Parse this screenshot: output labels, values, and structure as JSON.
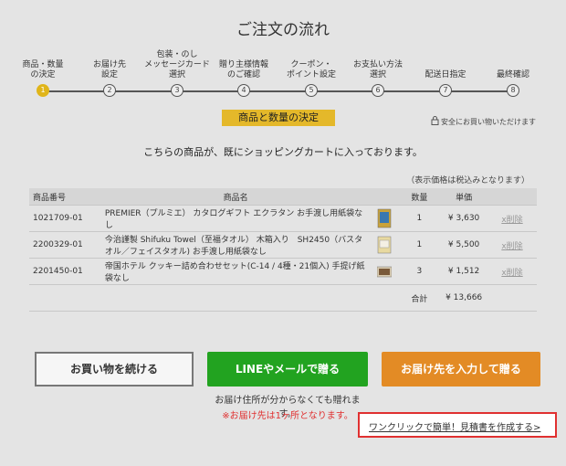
{
  "page_title": "ご注文の流れ",
  "steps": [
    {
      "label": "商品・数量\nの決定",
      "num": "1"
    },
    {
      "label": "お届け先\n設定",
      "num": "2"
    },
    {
      "label": "包装・のし\nメッセージカード\n選択",
      "num": "3"
    },
    {
      "label": "贈り主様情報\nのご確認",
      "num": "4"
    },
    {
      "label": "クーポン・\nポイント設定",
      "num": "5"
    },
    {
      "label": "お支払い方法\n選択",
      "num": "6"
    },
    {
      "label": "配送日指定",
      "num": "7"
    },
    {
      "label": "最終確認",
      "num": "8"
    }
  ],
  "current_step": 1,
  "section_title": "商品と数量の決定",
  "secure_text": "安全にお買い物いただけます",
  "notice": "こちらの商品が、既にショッピングカートに入っております。",
  "tax_note": "（表示価格は税込みとなります）",
  "table": {
    "headers": {
      "code": "商品番号",
      "name": "商品名",
      "qty": "数量",
      "price": "単価"
    },
    "rows": [
      {
        "code": "1021709-01",
        "name": "PREMIER（プルミエ） カタログギフト エクラタン お手渡し用紙袋なし",
        "qty": "1",
        "price": "¥ 3,630",
        "delete": "x削除"
      },
      {
        "code": "2200329-01",
        "name": "今治謹製 Shifuku Towel（至福タオル） 木箱入り　SH2450（バスタオル／フェイスタオル) お手渡し用紙袋なし",
        "qty": "1",
        "price": "¥ 5,500",
        "delete": "x削除"
      },
      {
        "code": "2201450-01",
        "name": "帝国ホテル クッキー詰め合わせセット(C-14 / 4種・21個入) 手提げ紙袋なし",
        "qty": "3",
        "price": "¥ 1,512",
        "delete": "x削除"
      }
    ],
    "total_label": "合計",
    "total_value": "¥ 13,666"
  },
  "buttons": {
    "continue": "お買い物を続ける",
    "line_mail": "LINEやメールで贈る",
    "address": "お届け先を入力して贈る"
  },
  "sub_note": "お届け住所が分からなくても贈れます。",
  "sub_warn": "※お届け先は1ヶ所となります。",
  "quote_link": "ワンクリックで簡単！見積書を作成する>",
  "colors": {
    "accent": "#e0b51a",
    "line_green": "#22a320",
    "orange": "#e38b25",
    "warn_red": "#e03030"
  }
}
